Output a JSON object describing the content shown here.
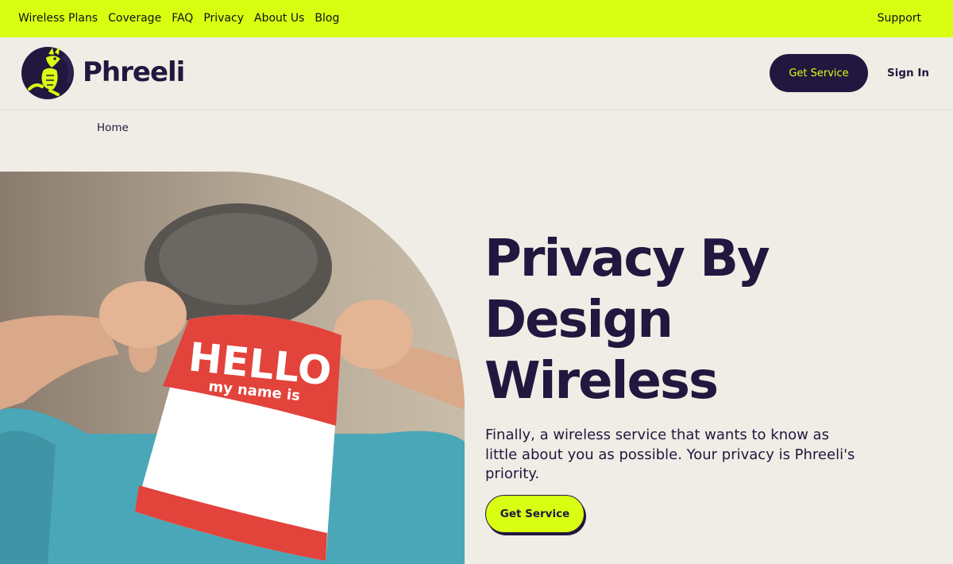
{
  "topnav": {
    "links": [
      "Wireless Plans",
      "Coverage",
      "FAQ",
      "Privacy",
      "About Us",
      "Blog"
    ],
    "support": "Support"
  },
  "header": {
    "logo_text": "Phreeli",
    "get_service": "Get Service",
    "sign_in": "Sign In"
  },
  "breadcrumb": {
    "home": "Home"
  },
  "hero": {
    "title": "Privacy By Design Wireless",
    "subtitle": "Finally, a wireless service that wants to know as little about you as possible. Your privacy is Phreeli's priority.",
    "cta": "Get Service",
    "sticker_hello": "HELLO",
    "sticker_name": "my name is"
  },
  "colors": {
    "accent": "#d8ff12",
    "brand_dark": "#21173f",
    "background": "#efede5",
    "sticker_red": "#e2433b"
  },
  "icons": {
    "logo": "kangaroo-logo-icon"
  }
}
